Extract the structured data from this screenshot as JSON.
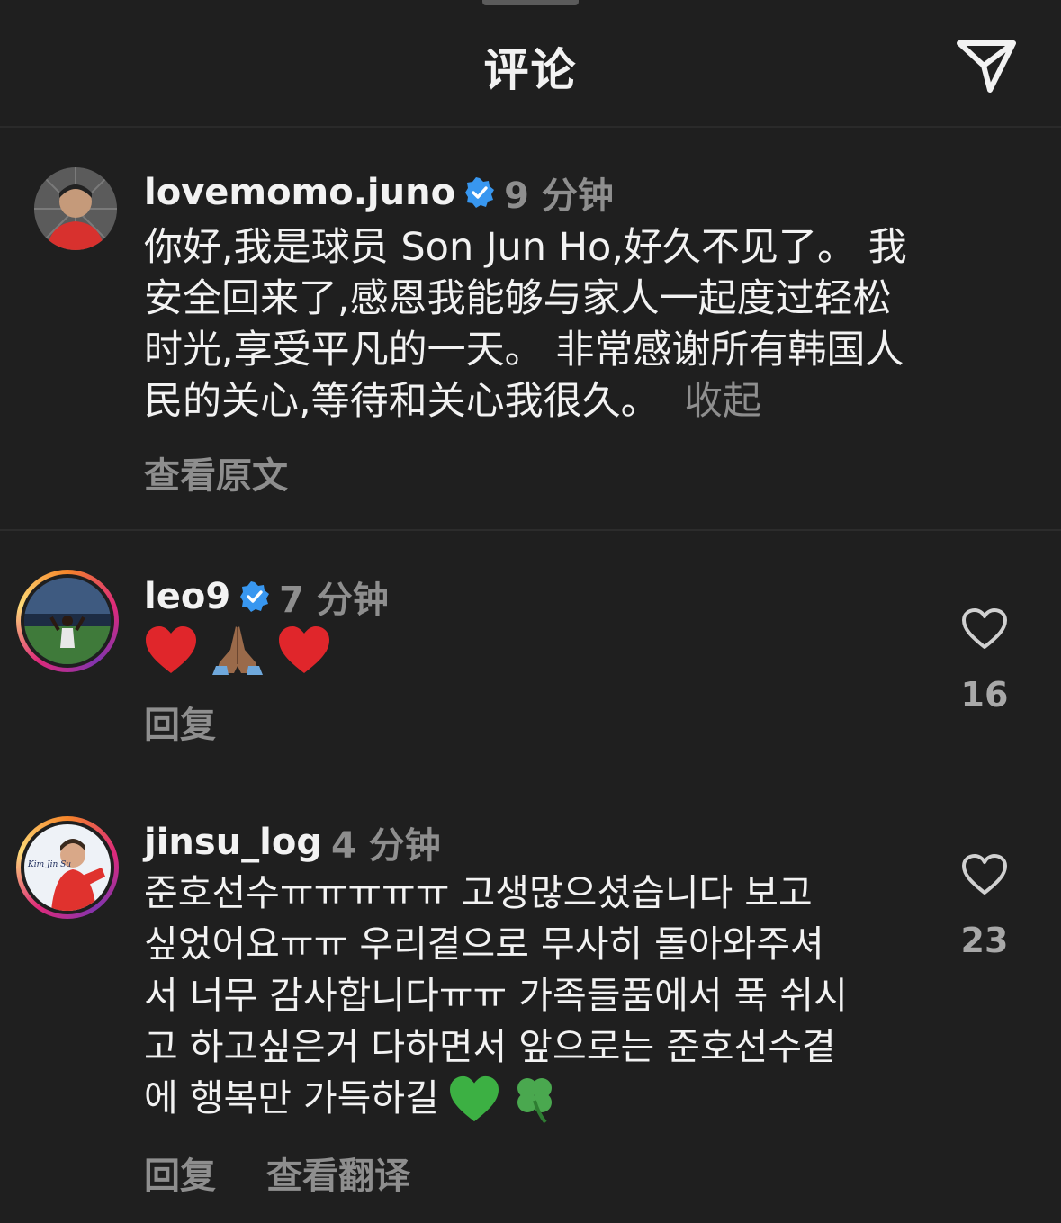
{
  "header": {
    "title": "评论"
  },
  "comments": [
    {
      "username": "lovemomo.juno",
      "verified": true,
      "time": "9 分钟",
      "lines": [
        "你好,我是球员 Son Jun Ho,好久不见了。 我",
        "安全回来了,感恩我能够与家人一起度过轻松",
        "时光,享受平凡的一天。 非常感谢所有韩国人",
        "民的关心,等待和关心我很久。"
      ],
      "collapse_label": "收起",
      "sub_action": "查看原文"
    },
    {
      "username": "leo9",
      "verified": true,
      "time": "7 分钟",
      "emoji_names": [
        "red-heart-icon",
        "folded-hands-icon",
        "red-heart-icon"
      ],
      "reply_label": "回复",
      "like_count": "16"
    },
    {
      "username": "jinsu_log",
      "verified": false,
      "time": "4 分钟",
      "avatar_label": "Kim Jin Su",
      "lines": [
        "준호선수ㅠㅠㅠㅠㅠ 고생많으셨습니다 보고",
        "싶었어요ㅠㅠ 우리곁으로 무사히 돌아와주셔",
        "서 너무 감사합니다ㅠㅠ 가족들품에서 푹 쉬시",
        "고 하고싶은거 다하면서 앞으로는 준호선수곁",
        "에 행복만 가득하길"
      ],
      "emoji_names": [
        "green-heart-icon",
        "four-leaf-clover-icon"
      ],
      "reply_label": "回复",
      "translate_label": "查看翻译",
      "like_count": "23"
    }
  ],
  "colors": {
    "background": "#1f1f1f",
    "text": "#f2f2f2",
    "secondary": "#8e8e8e",
    "verified": "#3897f0"
  }
}
